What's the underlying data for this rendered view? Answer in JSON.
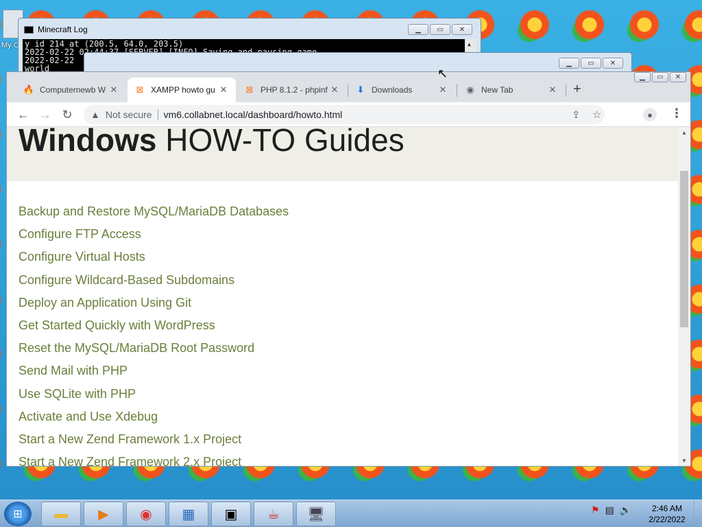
{
  "desktop": {
    "icon_label": "My C"
  },
  "console_window": {
    "title": "Minecraft Log",
    "lines": [
      "y id 214 at (200.5, 64.0, 203.5)",
      "2022-02-22 02:44:37 [SERVER] [INFO] Saving and pausing game...",
      "2022-02-22",
      "world"
    ]
  },
  "chrome": {
    "tabs": [
      {
        "title": "Computernewb W",
        "icon": "flame-icon"
      },
      {
        "title": "XAMPP howto gu",
        "icon": "xampp-icon"
      },
      {
        "title": "PHP 8.1.2 - phpinf",
        "icon": "xampp-icon"
      },
      {
        "title": "Downloads",
        "icon": "download-icon"
      },
      {
        "title": "New Tab",
        "icon": "chrome-icon"
      }
    ],
    "not_secure": "Not secure",
    "url": "vm6.collabnet.local/dashboard/howto.html"
  },
  "page": {
    "title_bold": "Windows",
    "title_light": "HOW-TO Guides",
    "guides": [
      "Backup and Restore MySQL/MariaDB Databases",
      "Configure FTP Access",
      "Configure Virtual Hosts",
      "Configure Wildcard-Based Subdomains",
      "Deploy an Application Using Git",
      "Get Started Quickly with WordPress",
      "Reset the MySQL/MariaDB Root Password",
      "Send Mail with PHP",
      "Use SQLite with PHP",
      "Activate and Use Xdebug",
      "Start a New Zend Framework 1.x Project",
      "Start a New Zend Framework 2.x Project"
    ]
  },
  "taskbar": {
    "time": "2:46 AM",
    "date": "2/22/2022"
  }
}
